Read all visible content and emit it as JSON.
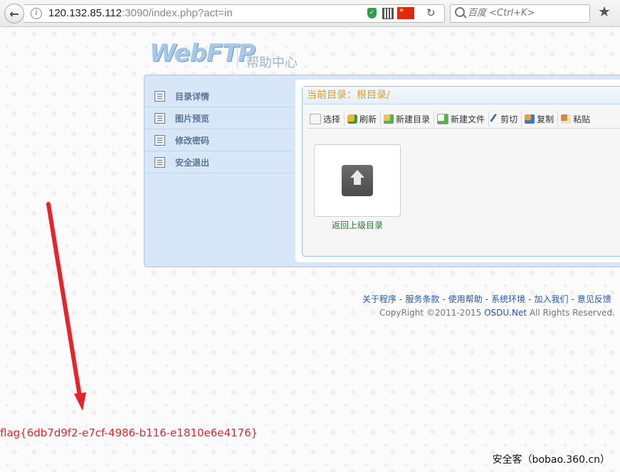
{
  "browser": {
    "url_host": "120.132.85.112",
    "url_rest": ":3090/index.php?act=in",
    "search_placeholder": "百度 <Ctrl+K>"
  },
  "header": {
    "logo": "WebFTP",
    "help_center": "帮助中心"
  },
  "sidebar": {
    "items": [
      {
        "label": "目录详情"
      },
      {
        "label": "图片预览"
      },
      {
        "label": "修改密码"
      },
      {
        "label": "安全退出"
      }
    ]
  },
  "main": {
    "current_dir": "当前目录：根目录/",
    "toolbar": [
      {
        "label": "选择",
        "icon": "select-icon"
      },
      {
        "label": "刷新",
        "icon": "refresh-icon"
      },
      {
        "label": "新建目录",
        "icon": "new-folder-icon"
      },
      {
        "label": "新建文件",
        "icon": "new-file-icon"
      },
      {
        "label": "剪切",
        "icon": "cut-icon"
      },
      {
        "label": "复制",
        "icon": "copy-icon"
      },
      {
        "label": "粘贴",
        "icon": "paste-icon"
      }
    ],
    "up_dir_label": "返回上级目录"
  },
  "footer": {
    "links": [
      "关于程序",
      "服务条款",
      "使用帮助",
      "系统环境",
      "加入我们",
      "意见反馈"
    ],
    "separator": "-",
    "copyright_prefix": "CopyRight ©2011-2015 ",
    "copyright_brand": "OSDU.Net",
    "copyright_suffix": " All Rights Reserved."
  },
  "annotation": {
    "flag": "flag{6db7d9f2-e7cf-4986-b116-e1810e6e4176}",
    "watermark": "安全客（bobao.360.cn）",
    "arrow_color": "#e8242b"
  }
}
